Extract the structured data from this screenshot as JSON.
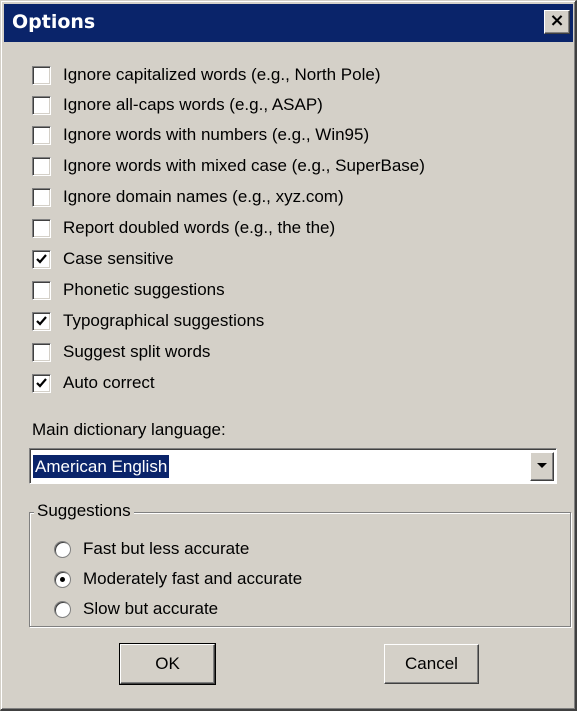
{
  "window": {
    "title": "Options",
    "close_glyph": "×"
  },
  "options": [
    {
      "label": "Ignore capitalized words (e.g., North Pole)",
      "checked": false
    },
    {
      "label": "Ignore all-caps words (e.g., ASAP)",
      "checked": false
    },
    {
      "label": "Ignore words with numbers (e.g., Win95)",
      "checked": false
    },
    {
      "label": "Ignore words with mixed case (e.g., SuperBase)",
      "checked": false
    },
    {
      "label": "Ignore domain names (e.g., xyz.com)",
      "checked": false
    },
    {
      "label": "Report doubled words (e.g., the the)",
      "checked": false
    },
    {
      "label": "Case sensitive",
      "checked": true
    },
    {
      "label": "Phonetic suggestions",
      "checked": false
    },
    {
      "label": "Typographical suggestions",
      "checked": true
    },
    {
      "label": "Suggest split words",
      "checked": false
    },
    {
      "label": "Auto correct",
      "checked": true
    }
  ],
  "dictionary": {
    "label": "Main dictionary language:",
    "selected": "American English"
  },
  "suggestions": {
    "title": "Suggestions",
    "options": [
      {
        "label": "Fast but less accurate",
        "selected": false
      },
      {
        "label": "Moderately fast and accurate",
        "selected": true
      },
      {
        "label": "Slow but accurate",
        "selected": false
      }
    ]
  },
  "buttons": {
    "ok": "OK",
    "cancel": "Cancel"
  },
  "colors": {
    "titlebar": "#0a246a",
    "face": "#d4d0c8",
    "selection": "#0a246a"
  }
}
